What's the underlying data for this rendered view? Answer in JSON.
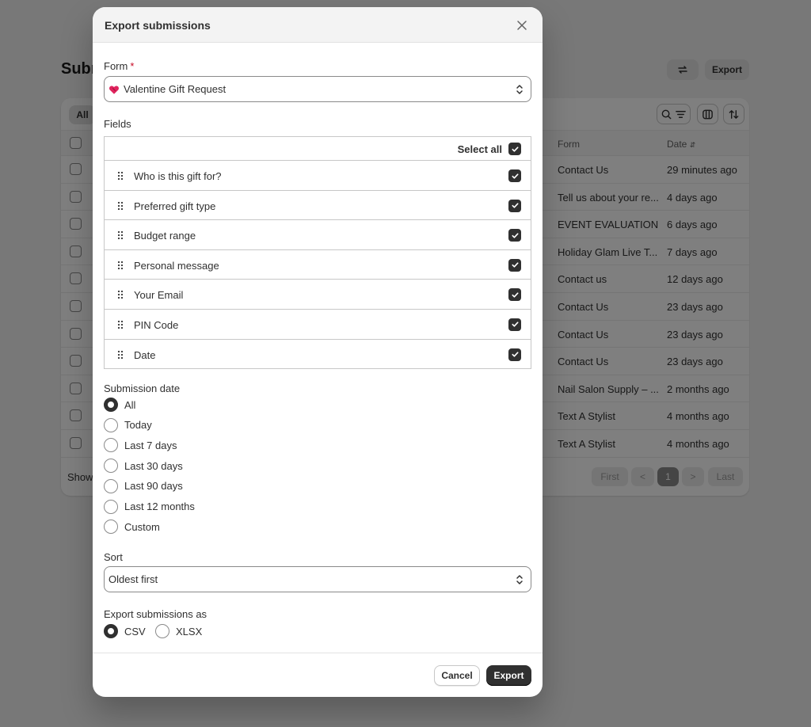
{
  "background": {
    "page_title": "Submissions",
    "header_buttons": {
      "export_label": "Export"
    },
    "tabs": [
      {
        "label": "All"
      }
    ],
    "columns": {
      "form": "Form",
      "date": "Date"
    },
    "rows": [
      {
        "form": "Contact Us",
        "date": "29 minutes ago"
      },
      {
        "form": "Tell us about your re...",
        "date": "4 days ago"
      },
      {
        "form": "EVENT EVALUATION",
        "date": "6 days ago"
      },
      {
        "form": "Holiday Glam Live T...",
        "date": "7 days ago"
      },
      {
        "form": "Contact us",
        "date": "12 days ago"
      },
      {
        "form": "Contact Us",
        "date": "23 days ago"
      },
      {
        "form": "Contact Us",
        "date": "23 days ago"
      },
      {
        "form": "Contact Us",
        "date": "23 days ago"
      },
      {
        "form": "Nail Salon Supply – ...",
        "date": "2 months ago"
      },
      {
        "form": "Text A Stylist",
        "date": "4 months ago"
      },
      {
        "form": "Text A Stylist",
        "date": "4 months ago"
      }
    ],
    "footer_show": "Show",
    "pagination": {
      "first": "First",
      "prev": "<",
      "current": "1",
      "next": ">",
      "last": "Last"
    }
  },
  "modal": {
    "title": "Export submissions",
    "form_label": "Form",
    "form_required_mark": "*",
    "form_value": "Valentine Gift Request",
    "fields_label": "Fields",
    "select_all_label": "Select all",
    "fields": [
      {
        "label": "Who is this gift for?",
        "checked": true
      },
      {
        "label": "Preferred gift type",
        "checked": true
      },
      {
        "label": "Budget range",
        "checked": true
      },
      {
        "label": "Personal message",
        "checked": true
      },
      {
        "label": "Your Email",
        "checked": true
      },
      {
        "label": "PIN Code",
        "checked": true
      },
      {
        "label": "Date",
        "checked": true
      }
    ],
    "submission_date_label": "Submission date",
    "date_options": [
      {
        "label": "All",
        "selected": true
      },
      {
        "label": "Today",
        "selected": false
      },
      {
        "label": "Last 7 days",
        "selected": false
      },
      {
        "label": "Last 30 days",
        "selected": false
      },
      {
        "label": "Last 90 days",
        "selected": false
      },
      {
        "label": "Last 12 months",
        "selected": false
      },
      {
        "label": "Custom",
        "selected": false
      }
    ],
    "sort_label": "Sort",
    "sort_value": "Oldest first",
    "export_as_label": "Export submissions as",
    "formats": [
      {
        "label": "CSV",
        "selected": true
      },
      {
        "label": "XLSX",
        "selected": false
      }
    ],
    "cancel_label": "Cancel",
    "export_label": "Export"
  },
  "colors": {
    "overlay": "#000000",
    "primary_button": "#303030",
    "required": "#c70a24",
    "heart": "#e0245e"
  }
}
